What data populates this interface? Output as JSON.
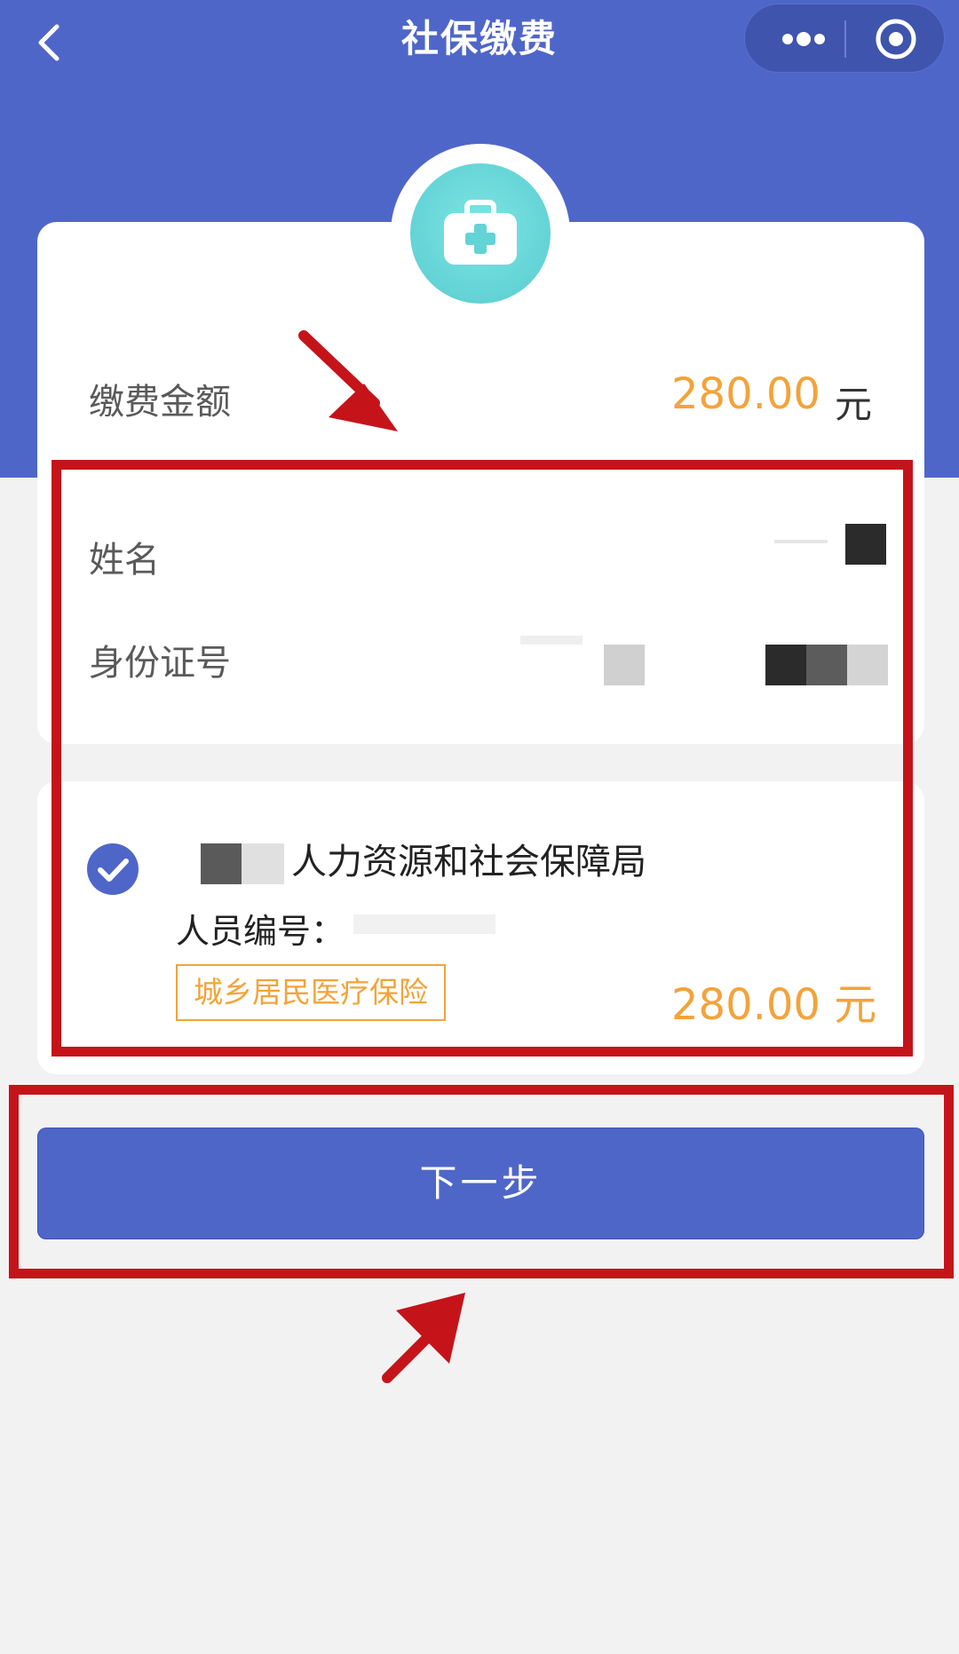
{
  "header": {
    "title": "社保缴费",
    "back_icon": "chevron-left-icon",
    "menu_icon": "more-dots-icon",
    "close_icon": "target-circle-icon"
  },
  "hero_icon": "medical-kit-icon",
  "payment": {
    "amount_label": "缴费金额",
    "amount_value": "280.00",
    "amount_unit": "元"
  },
  "person": {
    "name_label": "姓名",
    "id_label": "身份证号"
  },
  "insurance_item": {
    "bureau_name": "人力资源和社会保障局",
    "person_id_label": "人员编号：",
    "tag": "城乡居民医疗保险",
    "amount": "280.00 元",
    "checked": true
  },
  "actions": {
    "next_label": "下一步"
  },
  "colors": {
    "brand": "#4f66c9",
    "accent": "#f3a33a",
    "highlight": "#c4141a",
    "icon_teal": "#63d3d6"
  }
}
